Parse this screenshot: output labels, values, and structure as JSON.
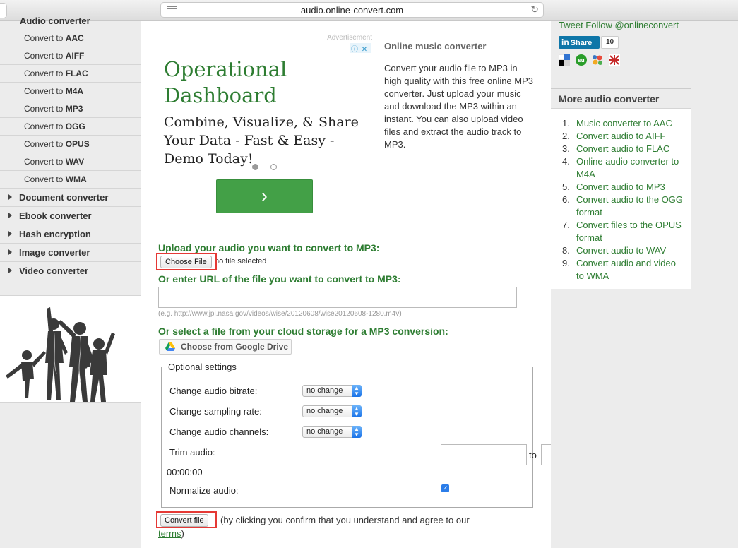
{
  "browser": {
    "url": "audio.online-convert.com"
  },
  "sidebar": {
    "cut_heading": "Audio converter",
    "sub_items": [
      {
        "prefix": "Convert to ",
        "format": "AAC"
      },
      {
        "prefix": "Convert to ",
        "format": "AIFF"
      },
      {
        "prefix": "Convert to ",
        "format": "FLAC"
      },
      {
        "prefix": "Convert to ",
        "format": "M4A"
      },
      {
        "prefix": "Convert to ",
        "format": "MP3"
      },
      {
        "prefix": "Convert to ",
        "format": "OGG"
      },
      {
        "prefix": "Convert to ",
        "format": "OPUS"
      },
      {
        "prefix": "Convert to ",
        "format": "WAV"
      },
      {
        "prefix": "Convert to ",
        "format": "WMA"
      }
    ],
    "categories": [
      "Document converter",
      "Ebook converter",
      "Hash encryption",
      "Image converter",
      "Video converter"
    ]
  },
  "ad": {
    "label": "Advertisement",
    "title": "Operational Dashboard",
    "subtitle": "Combine, Visualize, & Share Your Data - Fast & Easy - Demo Today!",
    "cta_icon": "chevron-right-icon"
  },
  "info": {
    "title": "Online music converter",
    "text": "Convert your audio file to MP3 in high quality with this free online MP3 converter. Just upload your music and download the MP3 within an instant. You can also upload video files and extract the audio track to MP3."
  },
  "upload": {
    "heading": "Upload your audio you want to convert to MP3:",
    "choose_label": "Choose File",
    "no_file": "no file selected",
    "url_heading": "Or enter URL of the file you want to convert to MP3:",
    "url_value": "",
    "url_example": "(e.g. http://www.jpl.nasa.gov/videos/wise/20120608/wise20120608-1280.m4v)",
    "cloud_heading": "Or select a file from your cloud storage for a MP3 conversion:",
    "gdrive_label": "Choose from Google Drive"
  },
  "settings": {
    "legend": "Optional settings",
    "bitrate_label": "Change audio bitrate:",
    "bitrate_value": "no change",
    "sampling_label": "Change sampling rate:",
    "sampling_value": "no change",
    "channels_label": "Change audio channels:",
    "channels_value": "no change",
    "trim_label": "Trim audio:",
    "trim_to": "to",
    "trim_start": "",
    "trim_end": "",
    "time_display": "00:00:00",
    "normalize_label": "Normalize audio:",
    "normalize_checked": true
  },
  "convert": {
    "button_label": "Convert file",
    "note_before": "(by clicking you confirm that you understand and agree to our ",
    "terms_link": "terms",
    "note_after": ")"
  },
  "right": {
    "tweet": "Tweet Follow @onlineconvert",
    "linkedin_label": "Share",
    "linkedin_in": "in",
    "linkedin_count": "10",
    "more_title": "More audio converter",
    "links": [
      "Music converter to AAC",
      "Convert audio to AIFF",
      "Convert audio to FLAC",
      "Online audio converter to M4A",
      "Convert audio to MP3",
      "Convert audio to the OGG format",
      "Convert files to the OPUS format",
      "Convert audio to WAV",
      "Convert audio and video to WMA"
    ]
  },
  "colors": {
    "accent_green": "#2e7d32",
    "highlight_red": "#e53935",
    "linkedin_blue": "#0e76a8"
  }
}
